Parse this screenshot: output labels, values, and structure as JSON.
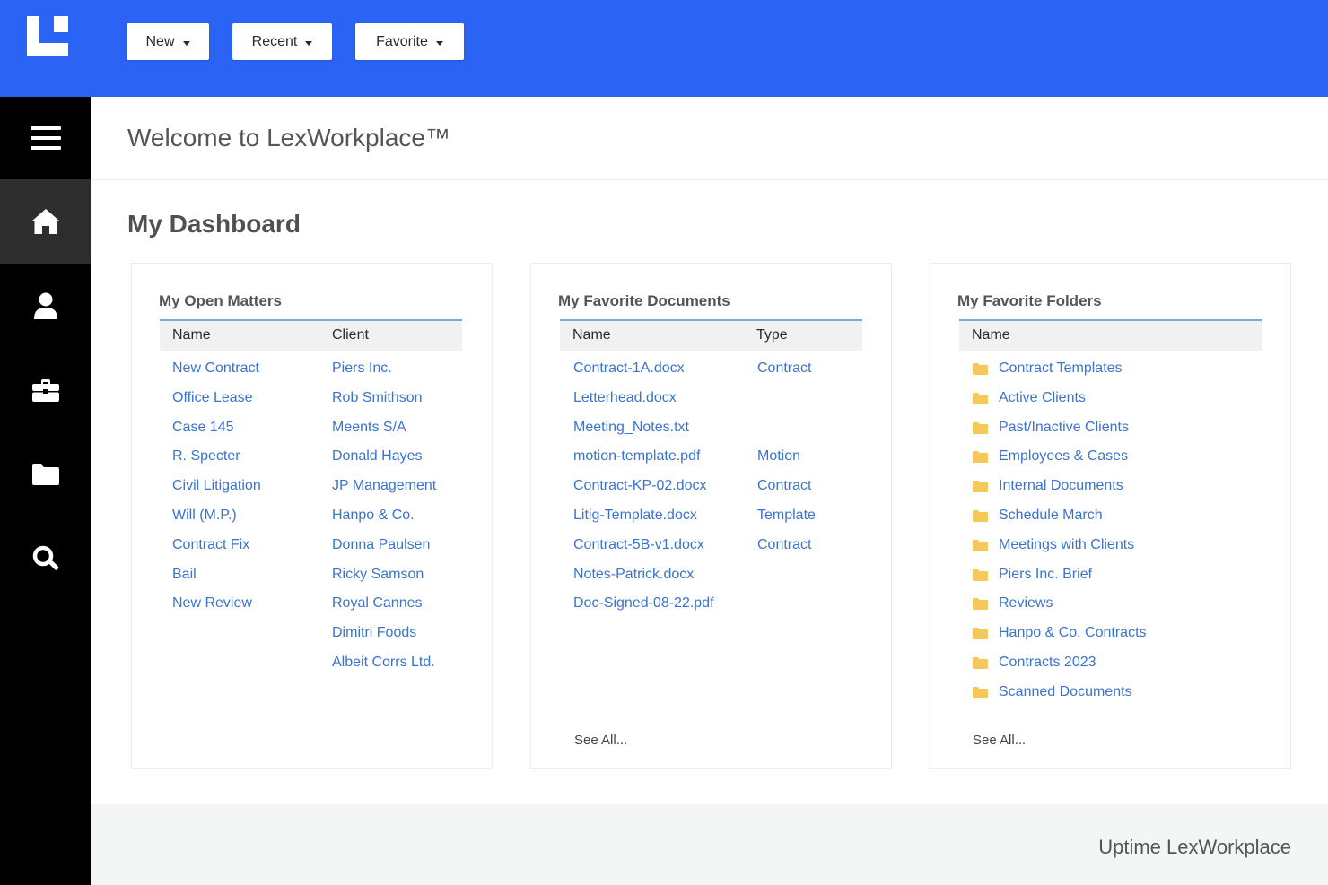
{
  "header": {
    "buttons": [
      {
        "label": "New"
      },
      {
        "label": "Recent"
      },
      {
        "label": "Favorite"
      }
    ]
  },
  "sidebar": {
    "items": [
      {
        "icon": "menu-icon"
      },
      {
        "icon": "home-icon",
        "active": true
      },
      {
        "icon": "user-icon"
      },
      {
        "icon": "briefcase-icon"
      },
      {
        "icon": "folder-icon"
      },
      {
        "icon": "search-icon"
      }
    ]
  },
  "welcome": {
    "title": "Welcome to LexWorkplace™"
  },
  "dashboard": {
    "title": "My Dashboard"
  },
  "open_matters": {
    "title": "My Open Matters",
    "columns": [
      "Name",
      "Client"
    ],
    "names": [
      "New Contract",
      "Office Lease",
      "Case 145",
      "R. Specter",
      "Civil Litigation",
      "Will (M.P.)",
      "Contract Fix",
      "Bail",
      "New Review"
    ],
    "clients": [
      "Piers Inc.",
      "Rob Smithson",
      "Meents S/A",
      "Donald Hayes",
      "JP Management",
      "Hanpo & Co.",
      "Donna Paulsen",
      "Ricky Samson",
      "Royal Cannes",
      "Dimitri Foods",
      "Albeit Corrs Ltd."
    ]
  },
  "favorite_documents": {
    "title": "My Favorite Documents",
    "columns": [
      "Name",
      "Type"
    ],
    "rows": [
      {
        "name": "Contract-1A.docx",
        "type": "Contract"
      },
      {
        "name": "Letterhead.docx",
        "type": ""
      },
      {
        "name": "Meeting_Notes.txt",
        "type": ""
      },
      {
        "name": "motion-template.pdf",
        "type": "Motion"
      },
      {
        "name": "Contract-KP-02.docx",
        "type": "Contract"
      },
      {
        "name": "Litig-Template.docx",
        "type": "Template"
      },
      {
        "name": "Contract-5B-v1.docx",
        "type": "Contract"
      },
      {
        "name": "Notes-Patrick.docx",
        "type": ""
      },
      {
        "name": "Doc-Signed-08-22.pdf",
        "type": ""
      }
    ],
    "see_all": "See All..."
  },
  "favorite_folders": {
    "title": "My Favorite Folders",
    "columns": [
      "Name"
    ],
    "folders": [
      "Contract Templates",
      "Active Clients",
      "Past/Inactive Clients",
      "Employees & Cases",
      "Internal Documents",
      "Schedule March",
      "Meetings with Clients",
      "Piers Inc. Brief",
      "Reviews",
      "Hanpo & Co. Contracts",
      "Contracts 2023",
      "Scanned Documents"
    ],
    "see_all": "See All..."
  },
  "footer": {
    "text": "Uptime LexWorkplace"
  },
  "colors": {
    "brand": "#2b63f5",
    "link": "#3b74c9",
    "folder": "#f5c85c",
    "sidebar": "#000000"
  }
}
